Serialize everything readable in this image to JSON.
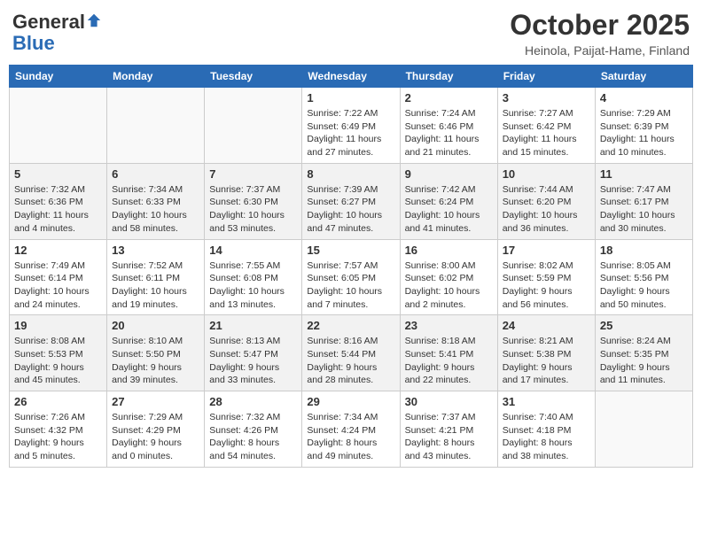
{
  "header": {
    "logo_general": "General",
    "logo_blue": "Blue",
    "month_title": "October 2025",
    "location": "Heinola, Paijat-Hame, Finland"
  },
  "days_of_week": [
    "Sunday",
    "Monday",
    "Tuesday",
    "Wednesday",
    "Thursday",
    "Friday",
    "Saturday"
  ],
  "weeks": [
    [
      {
        "day": "",
        "info": ""
      },
      {
        "day": "",
        "info": ""
      },
      {
        "day": "",
        "info": ""
      },
      {
        "day": "1",
        "info": "Sunrise: 7:22 AM\nSunset: 6:49 PM\nDaylight: 11 hours\nand 27 minutes."
      },
      {
        "day": "2",
        "info": "Sunrise: 7:24 AM\nSunset: 6:46 PM\nDaylight: 11 hours\nand 21 minutes."
      },
      {
        "day": "3",
        "info": "Sunrise: 7:27 AM\nSunset: 6:42 PM\nDaylight: 11 hours\nand 15 minutes."
      },
      {
        "day": "4",
        "info": "Sunrise: 7:29 AM\nSunset: 6:39 PM\nDaylight: 11 hours\nand 10 minutes."
      }
    ],
    [
      {
        "day": "5",
        "info": "Sunrise: 7:32 AM\nSunset: 6:36 PM\nDaylight: 11 hours\nand 4 minutes."
      },
      {
        "day": "6",
        "info": "Sunrise: 7:34 AM\nSunset: 6:33 PM\nDaylight: 10 hours\nand 58 minutes."
      },
      {
        "day": "7",
        "info": "Sunrise: 7:37 AM\nSunset: 6:30 PM\nDaylight: 10 hours\nand 53 minutes."
      },
      {
        "day": "8",
        "info": "Sunrise: 7:39 AM\nSunset: 6:27 PM\nDaylight: 10 hours\nand 47 minutes."
      },
      {
        "day": "9",
        "info": "Sunrise: 7:42 AM\nSunset: 6:24 PM\nDaylight: 10 hours\nand 41 minutes."
      },
      {
        "day": "10",
        "info": "Sunrise: 7:44 AM\nSunset: 6:20 PM\nDaylight: 10 hours\nand 36 minutes."
      },
      {
        "day": "11",
        "info": "Sunrise: 7:47 AM\nSunset: 6:17 PM\nDaylight: 10 hours\nand 30 minutes."
      }
    ],
    [
      {
        "day": "12",
        "info": "Sunrise: 7:49 AM\nSunset: 6:14 PM\nDaylight: 10 hours\nand 24 minutes."
      },
      {
        "day": "13",
        "info": "Sunrise: 7:52 AM\nSunset: 6:11 PM\nDaylight: 10 hours\nand 19 minutes."
      },
      {
        "day": "14",
        "info": "Sunrise: 7:55 AM\nSunset: 6:08 PM\nDaylight: 10 hours\nand 13 minutes."
      },
      {
        "day": "15",
        "info": "Sunrise: 7:57 AM\nSunset: 6:05 PM\nDaylight: 10 hours\nand 7 minutes."
      },
      {
        "day": "16",
        "info": "Sunrise: 8:00 AM\nSunset: 6:02 PM\nDaylight: 10 hours\nand 2 minutes."
      },
      {
        "day": "17",
        "info": "Sunrise: 8:02 AM\nSunset: 5:59 PM\nDaylight: 9 hours\nand 56 minutes."
      },
      {
        "day": "18",
        "info": "Sunrise: 8:05 AM\nSunset: 5:56 PM\nDaylight: 9 hours\nand 50 minutes."
      }
    ],
    [
      {
        "day": "19",
        "info": "Sunrise: 8:08 AM\nSunset: 5:53 PM\nDaylight: 9 hours\nand 45 minutes."
      },
      {
        "day": "20",
        "info": "Sunrise: 8:10 AM\nSunset: 5:50 PM\nDaylight: 9 hours\nand 39 minutes."
      },
      {
        "day": "21",
        "info": "Sunrise: 8:13 AM\nSunset: 5:47 PM\nDaylight: 9 hours\nand 33 minutes."
      },
      {
        "day": "22",
        "info": "Sunrise: 8:16 AM\nSunset: 5:44 PM\nDaylight: 9 hours\nand 28 minutes."
      },
      {
        "day": "23",
        "info": "Sunrise: 8:18 AM\nSunset: 5:41 PM\nDaylight: 9 hours\nand 22 minutes."
      },
      {
        "day": "24",
        "info": "Sunrise: 8:21 AM\nSunset: 5:38 PM\nDaylight: 9 hours\nand 17 minutes."
      },
      {
        "day": "25",
        "info": "Sunrise: 8:24 AM\nSunset: 5:35 PM\nDaylight: 9 hours\nand 11 minutes."
      }
    ],
    [
      {
        "day": "26",
        "info": "Sunrise: 7:26 AM\nSunset: 4:32 PM\nDaylight: 9 hours\nand 5 minutes."
      },
      {
        "day": "27",
        "info": "Sunrise: 7:29 AM\nSunset: 4:29 PM\nDaylight: 9 hours\nand 0 minutes."
      },
      {
        "day": "28",
        "info": "Sunrise: 7:32 AM\nSunset: 4:26 PM\nDaylight: 8 hours\nand 54 minutes."
      },
      {
        "day": "29",
        "info": "Sunrise: 7:34 AM\nSunset: 4:24 PM\nDaylight: 8 hours\nand 49 minutes."
      },
      {
        "day": "30",
        "info": "Sunrise: 7:37 AM\nSunset: 4:21 PM\nDaylight: 8 hours\nand 43 minutes."
      },
      {
        "day": "31",
        "info": "Sunrise: 7:40 AM\nSunset: 4:18 PM\nDaylight: 8 hours\nand 38 minutes."
      },
      {
        "day": "",
        "info": ""
      }
    ]
  ]
}
